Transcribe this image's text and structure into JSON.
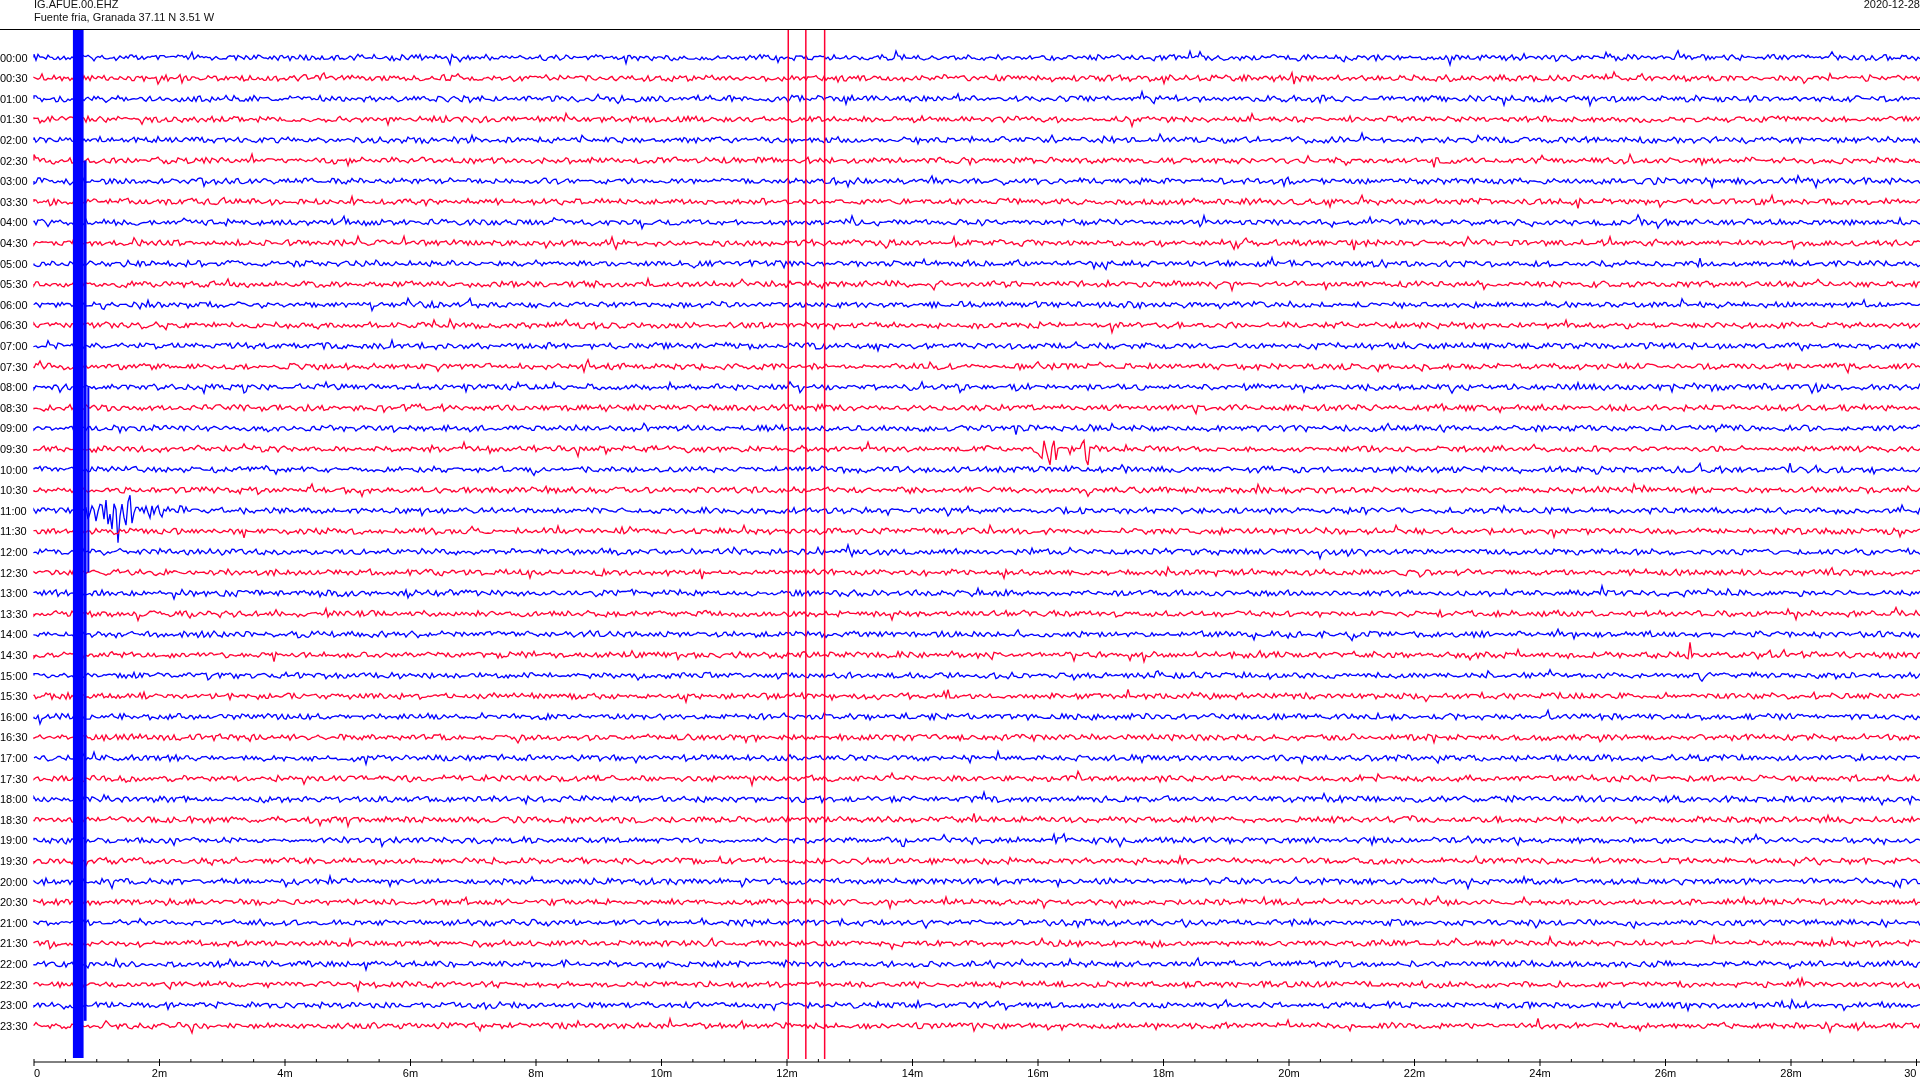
{
  "header": {
    "station": "IG.AFUE.00.EHZ",
    "location": "Fuente fria, Granada  37.11 N 3.51 W",
    "date": "2020-12-28"
  },
  "traces": [
    {
      "label": "00:00",
      "color": "#0000ff"
    },
    {
      "label": "00:30",
      "color": "#ff0033"
    },
    {
      "label": "01:00",
      "color": "#0000ff"
    },
    {
      "label": "01:30",
      "color": "#ff0033"
    },
    {
      "label": "02:00",
      "color": "#0000ff"
    },
    {
      "label": "02:30",
      "color": "#ff0033"
    },
    {
      "label": "03:00",
      "color": "#0000ff"
    },
    {
      "label": "03:30",
      "color": "#ff0033"
    },
    {
      "label": "04:00",
      "color": "#0000ff"
    },
    {
      "label": "04:30",
      "color": "#ff0033"
    },
    {
      "label": "05:00",
      "color": "#0000ff"
    },
    {
      "label": "05:30",
      "color": "#ff0033"
    },
    {
      "label": "06:00",
      "color": "#0000ff"
    },
    {
      "label": "06:30",
      "color": "#ff0033"
    },
    {
      "label": "07:00",
      "color": "#0000ff"
    },
    {
      "label": "07:30",
      "color": "#ff0033"
    },
    {
      "label": "08:00",
      "color": "#0000ff"
    },
    {
      "label": "08:30",
      "color": "#ff0033"
    },
    {
      "label": "09:00",
      "color": "#0000ff"
    },
    {
      "label": "09:30",
      "color": "#ff0033"
    },
    {
      "label": "10:00",
      "color": "#0000ff"
    },
    {
      "label": "10:30",
      "color": "#ff0033"
    },
    {
      "label": "11:00",
      "color": "#0000ff"
    },
    {
      "label": "11:30",
      "color": "#ff0033"
    },
    {
      "label": "12:00",
      "color": "#0000ff"
    },
    {
      "label": "12:30",
      "color": "#ff0033"
    },
    {
      "label": "13:00",
      "color": "#0000ff"
    },
    {
      "label": "13:30",
      "color": "#ff0033"
    },
    {
      "label": "14:00",
      "color": "#0000ff"
    },
    {
      "label": "14:30",
      "color": "#ff0033"
    },
    {
      "label": "15:00",
      "color": "#0000ff"
    },
    {
      "label": "15:30",
      "color": "#ff0033"
    },
    {
      "label": "16:00",
      "color": "#0000ff"
    },
    {
      "label": "16:30",
      "color": "#ff0033"
    },
    {
      "label": "17:00",
      "color": "#0000ff"
    },
    {
      "label": "17:30",
      "color": "#ff0033"
    },
    {
      "label": "18:00",
      "color": "#0000ff"
    },
    {
      "label": "18:30",
      "color": "#ff0033"
    },
    {
      "label": "19:00",
      "color": "#0000ff"
    },
    {
      "label": "19:30",
      "color": "#ff0033"
    },
    {
      "label": "20:00",
      "color": "#0000ff"
    },
    {
      "label": "20:30",
      "color": "#ff0033"
    },
    {
      "label": "21:00",
      "color": "#0000ff"
    },
    {
      "label": "21:30",
      "color": "#ff0033"
    },
    {
      "label": "22:00",
      "color": "#0000ff"
    },
    {
      "label": "22:30",
      "color": "#ff0033"
    },
    {
      "label": "23:00",
      "color": "#0000ff"
    },
    {
      "label": "23:30",
      "color": "#ff0033"
    }
  ],
  "time_axis": {
    "tick_labels": [
      "0",
      "2m",
      "4m",
      "6m",
      "8m",
      "10m",
      "12m",
      "14m",
      "16m",
      "18m",
      "20m",
      "22m",
      "24m",
      "26m",
      "28m",
      "30"
    ]
  }
}
